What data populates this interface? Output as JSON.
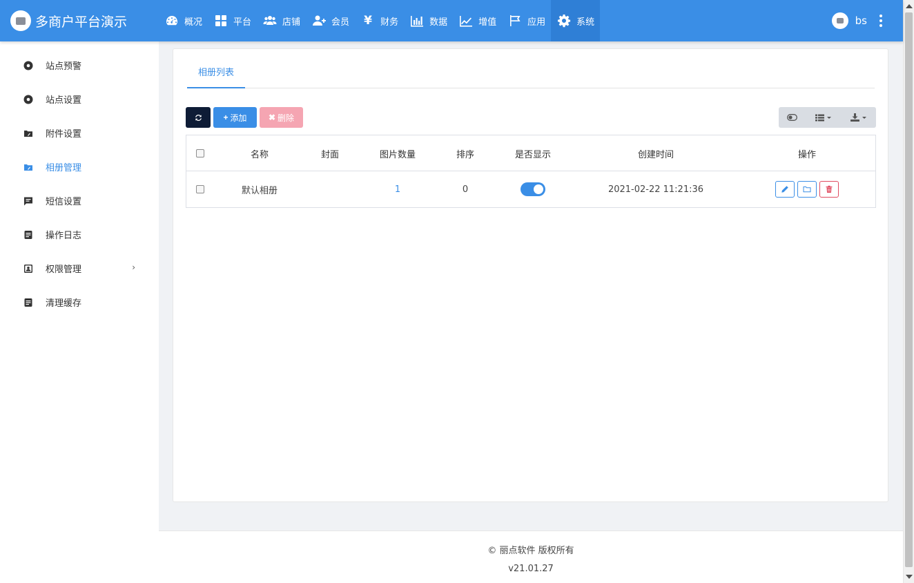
{
  "app": {
    "title": "多商户平台演示"
  },
  "nav": {
    "items": [
      {
        "label": "概况",
        "icon": "dashboard-icon"
      },
      {
        "label": "平台",
        "icon": "grid-icon"
      },
      {
        "label": "店铺",
        "icon": "users-group-icon"
      },
      {
        "label": "会员",
        "icon": "user-plus-icon"
      },
      {
        "label": "财务",
        "icon": "yen-icon",
        "glyph": "¥"
      },
      {
        "label": "数据",
        "icon": "bar-chart-icon"
      },
      {
        "label": "增值",
        "icon": "line-chart-icon"
      },
      {
        "label": "应用",
        "icon": "flag-icon"
      },
      {
        "label": "系统",
        "icon": "gear-icon",
        "active": true
      }
    ]
  },
  "user": {
    "name": "bs"
  },
  "sidebar": {
    "items": [
      {
        "label": "站点预警",
        "icon": "circle-dot-icon"
      },
      {
        "label": "站点设置",
        "icon": "circle-dot-icon"
      },
      {
        "label": "附件设置",
        "icon": "folder-clip-icon"
      },
      {
        "label": "相册管理",
        "icon": "folder-clip-icon",
        "active": true
      },
      {
        "label": "短信设置",
        "icon": "message-icon"
      },
      {
        "label": "操作日志",
        "icon": "document-icon"
      },
      {
        "label": "权限管理",
        "icon": "user-badge-icon",
        "has_children": true
      },
      {
        "label": "清理缓存",
        "icon": "document-icon"
      }
    ]
  },
  "tabs": [
    {
      "label": "相册列表",
      "active": true
    }
  ],
  "toolbar": {
    "add_label": "添加",
    "add_glyph": "+",
    "delete_label": "删除",
    "delete_glyph": "✖"
  },
  "table": {
    "headers": [
      "名称",
      "封面",
      "图片数量",
      "排序",
      "是否显示",
      "创建时间",
      "操作"
    ],
    "rows": [
      {
        "name": "默认相册",
        "cover": "",
        "image_count": "1",
        "sort": "0",
        "visible": true,
        "created_at": "2021-02-22 11:21:36"
      }
    ]
  },
  "footer": {
    "copyright": "© 丽点软件 版权所有",
    "version": "v21.01.27"
  },
  "colors": {
    "primary": "#3a8ee6",
    "dark": "#0e1c36",
    "danger_light": "#f5a5b2",
    "danger": "#e04a5f"
  }
}
